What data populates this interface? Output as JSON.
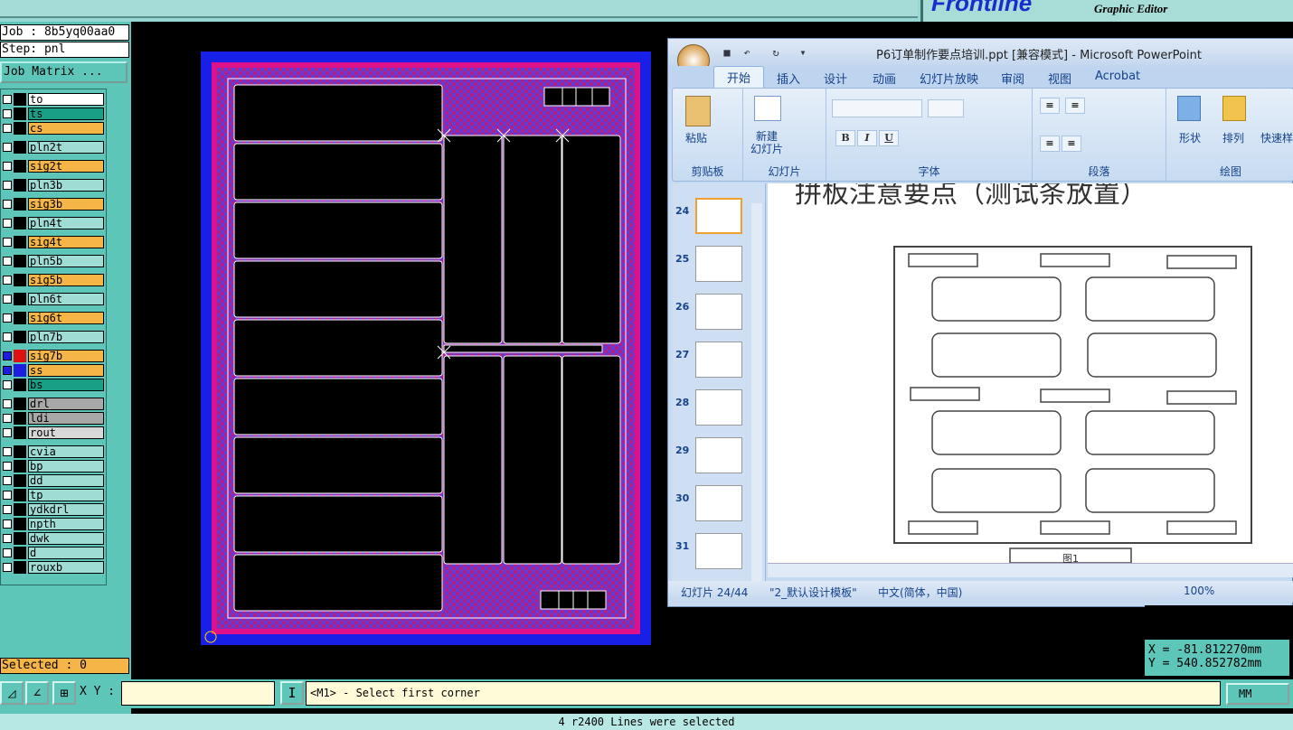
{
  "header": {
    "top_title": "",
    "logo": "Frontline",
    "app_subtitle": "Graphic Editor"
  },
  "left": {
    "job": "Job : 8b5yq00aa0",
    "step": "Step: pnl",
    "job_matrix": "Job Matrix ...",
    "selected": "Selected : 0",
    "layers": [
      {
        "name": "to",
        "color": "#ffffff"
      },
      {
        "name": "ts",
        "color": "#1a9f87"
      },
      {
        "name": "cs",
        "color": "#f5b547"
      },
      {
        "name": "pln2t",
        "color": "#9fdcd4"
      },
      {
        "name": "sig2t",
        "color": "#f5b547"
      },
      {
        "name": "pln3b",
        "color": "#9fdcd4"
      },
      {
        "name": "sig3b",
        "color": "#f5b547"
      },
      {
        "name": "pln4t",
        "color": "#9fdcd4"
      },
      {
        "name": "sig4t",
        "color": "#f5b547"
      },
      {
        "name": "pln5b",
        "color": "#9fdcd4"
      },
      {
        "name": "sig5b",
        "color": "#f5b547"
      },
      {
        "name": "pln6t",
        "color": "#9fdcd4"
      },
      {
        "name": "sig6t",
        "color": "#f5b547"
      },
      {
        "name": "pln7b",
        "color": "#9fdcd4"
      },
      {
        "name": "sig7b",
        "color": "#f5b547"
      },
      {
        "name": "ss",
        "color": "#f5b547"
      },
      {
        "name": "bs",
        "color": "#1a9f87"
      },
      {
        "name": "drl",
        "color": "#a8a8a8"
      },
      {
        "name": "ldi",
        "color": "#a8a8a8"
      },
      {
        "name": "rout",
        "color": "#d8d8d8"
      },
      {
        "name": "cvia",
        "color": "#9fdcd4"
      },
      {
        "name": "bp",
        "color": "#9fdcd4"
      },
      {
        "name": "dd",
        "color": "#9fdcd4"
      },
      {
        "name": "tp",
        "color": "#9fdcd4"
      },
      {
        "name": "ydkdrl",
        "color": "#9fdcd4"
      },
      {
        "name": "npth",
        "color": "#9fdcd4"
      },
      {
        "name": "dwk",
        "color": "#9fdcd4"
      },
      {
        "name": "d",
        "color": "#9fdcd4"
      },
      {
        "name": "rouxb",
        "color": "#9fdcd4"
      }
    ]
  },
  "bottom": {
    "xy_label": "X Y :",
    "xy_value": "",
    "prompt": "<M1> - Select first corner",
    "units": "MM",
    "status": "4 r2400 Lines were selected"
  },
  "coords": {
    "x": "X = -81.812270mm",
    "y": "Y =  540.852782mm"
  },
  "ppt": {
    "title": "P6订单制作要点培训.ppt [兼容模式] - Microsoft PowerPoint",
    "tabs": [
      "开始",
      "插入",
      "设计",
      "动画",
      "幻灯片放映",
      "审阅",
      "视图",
      "Acrobat"
    ],
    "groups": {
      "clipboard": "剪贴板",
      "paste": "粘贴",
      "slides": "幻灯片",
      "new_slide_1": "新建",
      "new_slide_2": "幻灯片",
      "font": "字体",
      "paragraph": "段落",
      "drawing": "绘图",
      "shape": "形状",
      "arrange": "排列",
      "quick_style": "快速样"
    },
    "slide_numbers": [
      "24",
      "25",
      "26",
      "27",
      "28",
      "29",
      "30",
      "31"
    ],
    "slide_heading": "拼板注意要点（测试条放置）",
    "figure_label": "图1",
    "status": {
      "slide": "幻灯片 24/44",
      "theme": "\"2_默认设计模板\"",
      "lang": "中文(简体，中国)",
      "zoom": "100%"
    }
  }
}
